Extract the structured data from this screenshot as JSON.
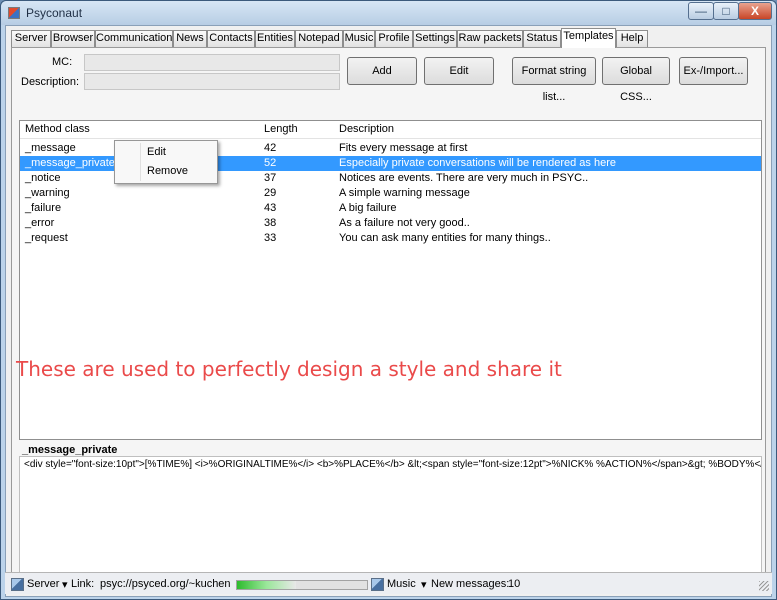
{
  "window": {
    "title": "Psyconaut",
    "min_label": "—",
    "max_label": "□",
    "close_label": "X"
  },
  "tabs": [
    {
      "label": "Server"
    },
    {
      "label": "Browser"
    },
    {
      "label": "Communication"
    },
    {
      "label": "News"
    },
    {
      "label": "Contacts"
    },
    {
      "label": "Entities"
    },
    {
      "label": "Notepad"
    },
    {
      "label": "Music"
    },
    {
      "label": "Profile"
    },
    {
      "label": "Settings"
    },
    {
      "label": "Raw packets"
    },
    {
      "label": "Status"
    },
    {
      "label": "Templates",
      "active": true
    },
    {
      "label": "Help"
    }
  ],
  "form": {
    "mc_label": "MC:",
    "mc_value": "",
    "description_label": "Description:",
    "description_value": ""
  },
  "buttons": {
    "add": "Add",
    "edit": "Edit",
    "format_string_list": "Format string list...",
    "global_css": "Global CSS...",
    "ex_import": "Ex-/Import..."
  },
  "list": {
    "columns": [
      "Method class",
      "Length",
      "Description"
    ],
    "rows": [
      {
        "method": "_message",
        "length": "42",
        "description": "Fits every message at first"
      },
      {
        "method": "_message_private",
        "length": "52",
        "description": "Especially private conversations will be rendered as here",
        "selected": true
      },
      {
        "method": "_notice",
        "length": "37",
        "description": "Notices are events. There are very much in PSYC.."
      },
      {
        "method": "_warning",
        "length": "29",
        "description": "A simple warning message"
      },
      {
        "method": "_failure",
        "length": "43",
        "description": "A big failure"
      },
      {
        "method": "_error",
        "length": "38",
        "description": "As a failure not very good.."
      },
      {
        "method": "_request",
        "length": "33",
        "description": "You can ask many entities for many things.."
      }
    ]
  },
  "context_menu": {
    "items": [
      "Edit",
      "Remove"
    ]
  },
  "overlay_caption": "These are used to perfectly design a style and share it",
  "preview": {
    "title": "_message_private",
    "content": "<div style=\"font-size:10pt\">[%TIME%] <i>%ORIGINALTIME%</i> <b>%PLACE%</b> &lt;<span style=\"font-size:12pt\">%NICK% %ACTION%</span>&gt; %BODY%</div>"
  },
  "statusbar": {
    "server_label": "Server",
    "link_label": "Link:",
    "link_value": "psyc://psyced.org/~kuchen",
    "progress": 0.45,
    "music_label": "Music",
    "new_messages_label": "New messages:",
    "new_messages_count": "10",
    "dropdown_arrow": "▾"
  },
  "colors": {
    "selection": "#3399ff",
    "overlay_text": "#ea4a4a",
    "progress": "#2dbb2d"
  },
  "icons": [
    "app-icon",
    "server-icon",
    "music-icon",
    "resize-grip-icon"
  ]
}
